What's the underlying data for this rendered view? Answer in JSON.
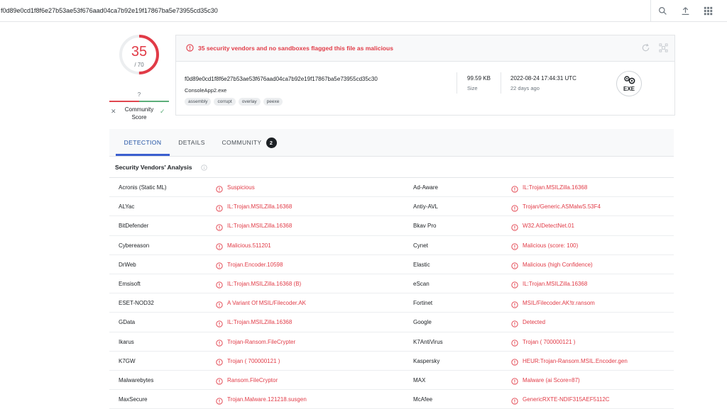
{
  "search": {
    "value": "f0d89e0cd1f8f6e27b53ae53f676aad04ca7b92e19f17867ba5e73955cd35c30",
    "icons": [
      "search-icon",
      "upload-icon",
      "apps-grid-icon"
    ]
  },
  "score": {
    "detections": "35",
    "total": "/ 70",
    "fraction": 0.5,
    "community_value": "?",
    "community_label_1": "Community",
    "community_label_2": "Score"
  },
  "alert": {
    "text": "35 security vendors and no sandboxes flagged this file as malicious"
  },
  "file": {
    "hash": "f0d89e0cd1f8f6e27b53ae53f676aad04ca7b92e19f17867ba5e73955cd35c30",
    "name": "ConsoleApp2.exe",
    "tags": [
      "assembly",
      "corrupt",
      "overlay",
      "peexe"
    ],
    "size": "99.59 KB",
    "size_label": "Size",
    "date": "2022-08-24 17:44:31 UTC",
    "date_ago": "22 days ago",
    "type": "EXE"
  },
  "tabs": [
    {
      "label": "DETECTION"
    },
    {
      "label": "DETAILS"
    },
    {
      "label": "COMMUNITY",
      "badge": "2"
    }
  ],
  "section": {
    "title": "Security Vendors' Analysis"
  },
  "colors": {
    "malicious": "#e13b47",
    "accent": "#3b5fcf",
    "harmless": "#5dae7a"
  },
  "vendors": [
    {
      "left": {
        "vendor": "Acronis (Static ML)",
        "result": "Suspicious"
      },
      "right": {
        "vendor": "Ad-Aware",
        "result": "IL:Trojan.MSILZilla.16368"
      }
    },
    {
      "left": {
        "vendor": "ALYac",
        "result": "IL:Trojan.MSILZilla.16368"
      },
      "right": {
        "vendor": "Antiy-AVL",
        "result": "Trojan/Generic.ASMalwS.53F4"
      }
    },
    {
      "left": {
        "vendor": "BitDefender",
        "result": "IL:Trojan.MSILZilla.16368"
      },
      "right": {
        "vendor": "Bkav Pro",
        "result": "W32.AIDetectNet.01"
      }
    },
    {
      "left": {
        "vendor": "Cybereason",
        "result": "Malicious.511201"
      },
      "right": {
        "vendor": "Cynet",
        "result": "Malicious (score: 100)"
      }
    },
    {
      "left": {
        "vendor": "DrWeb",
        "result": "Trojan.Encoder.10598"
      },
      "right": {
        "vendor": "Elastic",
        "result": "Malicious (high Confidence)"
      }
    },
    {
      "left": {
        "vendor": "Emsisoft",
        "result": "IL:Trojan.MSILZilla.16368 (B)"
      },
      "right": {
        "vendor": "eScan",
        "result": "IL:Trojan.MSILZilla.16368"
      }
    },
    {
      "left": {
        "vendor": "ESET-NOD32",
        "result": "A Variant Of MSIL/Filecoder.AK"
      },
      "right": {
        "vendor": "Fortinet",
        "result": "MSIL/Filecoder.AK!tr.ransom"
      }
    },
    {
      "left": {
        "vendor": "GData",
        "result": "IL:Trojan.MSILZilla.16368"
      },
      "right": {
        "vendor": "Google",
        "result": "Detected"
      }
    },
    {
      "left": {
        "vendor": "Ikarus",
        "result": "Trojan-Ransom.FileCrypter"
      },
      "right": {
        "vendor": "K7AntiVirus",
        "result": "Trojan ( 700000121 )"
      }
    },
    {
      "left": {
        "vendor": "K7GW",
        "result": "Trojan ( 700000121 )"
      },
      "right": {
        "vendor": "Kaspersky",
        "result": "HEUR:Trojan-Ransom.MSIL.Encoder.gen"
      }
    },
    {
      "left": {
        "vendor": "Malwarebytes",
        "result": "Ransom.FileCryptor"
      },
      "right": {
        "vendor": "MAX",
        "result": "Malware (ai Score=87)"
      }
    },
    {
      "left": {
        "vendor": "MaxSecure",
        "result": "Trojan.Malware.121218.susgen"
      },
      "right": {
        "vendor": "McAfee",
        "result": "GenericRXTE-NDIF315AEF5112C"
      }
    }
  ]
}
